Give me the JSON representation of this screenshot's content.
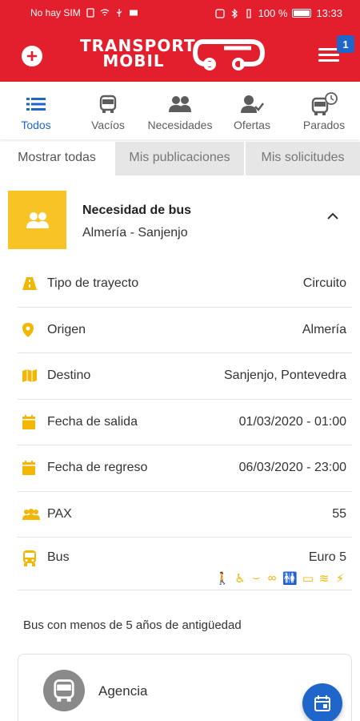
{
  "status_bar": {
    "carrier": "No hay SIM",
    "battery": "100 %",
    "time": "13:33"
  },
  "header": {
    "logo_line1": "TRANSPORT",
    "logo_line2": "MOBIL",
    "menu_badge": "1",
    "brand_color": "#e31e2d"
  },
  "tabs": [
    {
      "label": "Todos",
      "icon": "list-icon",
      "active": true
    },
    {
      "label": "Vacíos",
      "icon": "bus-icon",
      "active": false
    },
    {
      "label": "Necesidades",
      "icon": "people-icon",
      "active": false
    },
    {
      "label": "Ofertas",
      "icon": "person-check-icon",
      "active": false
    },
    {
      "label": "Parados",
      "icon": "bus-clock-icon",
      "active": false
    }
  ],
  "subtabs": [
    {
      "label": "Mostrar todas",
      "active": true
    },
    {
      "label": "Mis publicaciones",
      "active": false
    },
    {
      "label": "Mis solicitudes",
      "active": false
    }
  ],
  "card": {
    "title": "Necesidad de bus",
    "route": "Almería - Sanjenjo",
    "accent": "#f7c325"
  },
  "details": [
    {
      "label": "Tipo de trayecto",
      "value": "Circuito",
      "icon": "road-icon"
    },
    {
      "label": "Origen",
      "value": "Almería",
      "icon": "location-pin-icon"
    },
    {
      "label": "Destino",
      "value": "Sanjenjo, Pontevedra",
      "icon": "map-icon"
    },
    {
      "label": "Fecha de salida",
      "value": "01/03/2020 - 01:00",
      "icon": "calendar-icon"
    },
    {
      "label": "Fecha de regreso",
      "value": "06/03/2020 - 23:00",
      "icon": "calendar-icon"
    },
    {
      "label": "PAX",
      "value": "55",
      "icon": "group-icon"
    },
    {
      "label": "Bus",
      "value": "Euro 5",
      "icon": "bus-front-icon"
    }
  ],
  "amenities": [
    "guide-walking-icon",
    "wheelchair-icon",
    "reclining-seat-icon",
    "seatbelt-icon",
    "toilet-icon",
    "screen-icon",
    "wifi-icon",
    "plug-icon"
  ],
  "note": "Bus con menos de 5 años de antigüedad",
  "agency": {
    "name": "Agencia"
  },
  "accent_blue": "#1e66c9",
  "amenity_color": "#f2b705"
}
